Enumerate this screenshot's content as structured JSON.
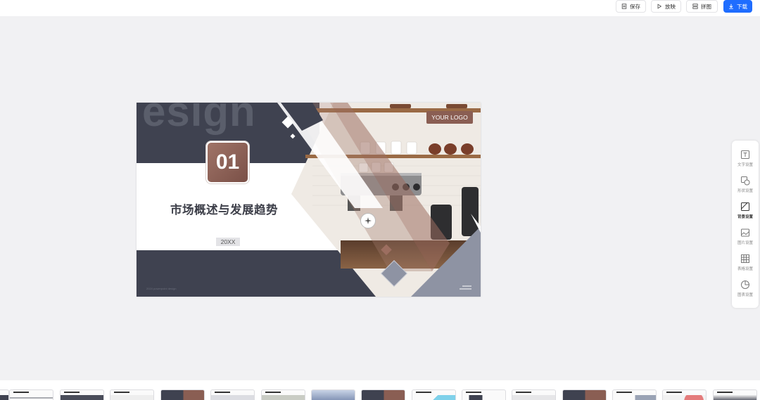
{
  "toolbar": {
    "save_label": "保存",
    "play_label": "放映",
    "combine_label": "拼图",
    "download_label": "下载"
  },
  "slide": {
    "watermark_word": "esign",
    "logo_text": "YOUR LOGO",
    "number": "01",
    "title": "市场概述与发展趋势",
    "year": "20XX",
    "footer": "2024 powerpoint design"
  },
  "right_panel": {
    "items": [
      {
        "label": "文字设置",
        "icon": "text-icon"
      },
      {
        "label": "形状设置",
        "icon": "shape-icon"
      },
      {
        "label": "背景设置",
        "icon": "background-icon"
      },
      {
        "label": "图片设置",
        "icon": "image-icon"
      },
      {
        "label": "表格设置",
        "icon": "table-icon"
      },
      {
        "label": "图表设置",
        "icon": "chart-icon"
      }
    ],
    "active_index": 2
  },
  "colors": {
    "accent": "#1f6dff",
    "slate": "#3f4250",
    "brown": "#8a5e53",
    "gray_blue": "#8e93a3"
  }
}
